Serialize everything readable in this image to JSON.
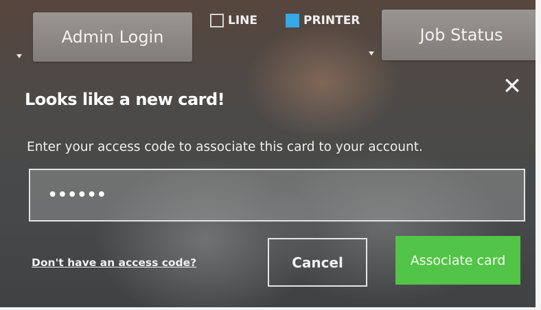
{
  "topbar": {
    "admin_login_label": "Admin Login",
    "job_status_label": "Job Status",
    "toggles": [
      {
        "label": "LINE",
        "checked": false
      },
      {
        "label": "PRINTER",
        "checked": true
      }
    ]
  },
  "dialog": {
    "title": "Looks like a new card!",
    "instructions": "Enter your access code to associate this card to your account.",
    "access_code_value": "••••••",
    "no_code_link": "Don't have an access code?",
    "cancel_label": "Cancel",
    "associate_label": "Associate card",
    "close_glyph": "✕"
  },
  "colors": {
    "associate_button": "#52c447",
    "printer_checkbox": "#35a8e6"
  }
}
